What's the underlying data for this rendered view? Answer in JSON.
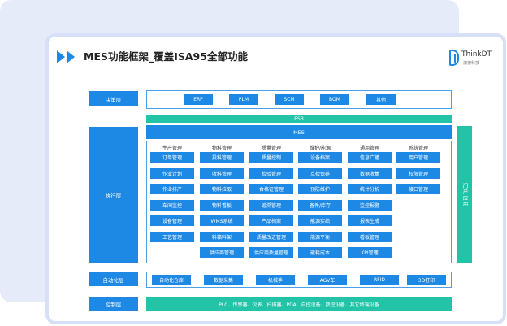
{
  "title": "MES功能框架_覆盖ISA95全部功能",
  "logo": {
    "name": "ThinkDT",
    "sub": "澳德科技"
  },
  "layers": {
    "decision": "决策层",
    "execution": "执行层",
    "automation": "自动化层",
    "control": "控制层"
  },
  "decision_systems": [
    "ERP",
    "PLM",
    "SCM",
    "BOM",
    "其他"
  ],
  "esb": "ESB",
  "mes": "MES",
  "portal": "门户应用",
  "columns": [
    {
      "title": "生产管理",
      "items": [
        "订单管理",
        "作业计划",
        "作业排产",
        "车间监控",
        "设备管理",
        "工艺管理"
      ]
    },
    {
      "title": "物料管理",
      "items": [
        "投料管理",
        "收料管理",
        "物料拉取",
        "物料看板",
        "WMS系统",
        "料箱料架",
        "供应商管理"
      ]
    },
    {
      "title": "质量管理",
      "items": [
        "质量控制",
        "检验管理",
        "合格证管理",
        "追溯管理",
        "产品档案",
        "质量改进管理",
        "供应商质量管理"
      ]
    },
    {
      "title": "维护/能源",
      "items": [
        "设备档案",
        "点检保养",
        "预防维护",
        "备件/库存",
        "能源实绩",
        "能源平衡",
        "能耗成本"
      ]
    },
    {
      "title": "通用管理",
      "items": [
        "信息广播",
        "数据收集",
        "统计分析",
        "监控报警",
        "报表生成",
        "看板管理",
        "KPI管理"
      ]
    },
    {
      "title": "系统管理",
      "items": [
        "用户管理",
        "权限管理",
        "接口管理",
        "......"
      ]
    }
  ],
  "automation_items": [
    "自动化仓库",
    "数据采集",
    "机械手",
    "AGV车",
    "RFID",
    "3D打印"
  ],
  "control_text": "PLC、传感器、仪表、扫描器、PDA、自控设备、数控设备、其它终端设备"
}
